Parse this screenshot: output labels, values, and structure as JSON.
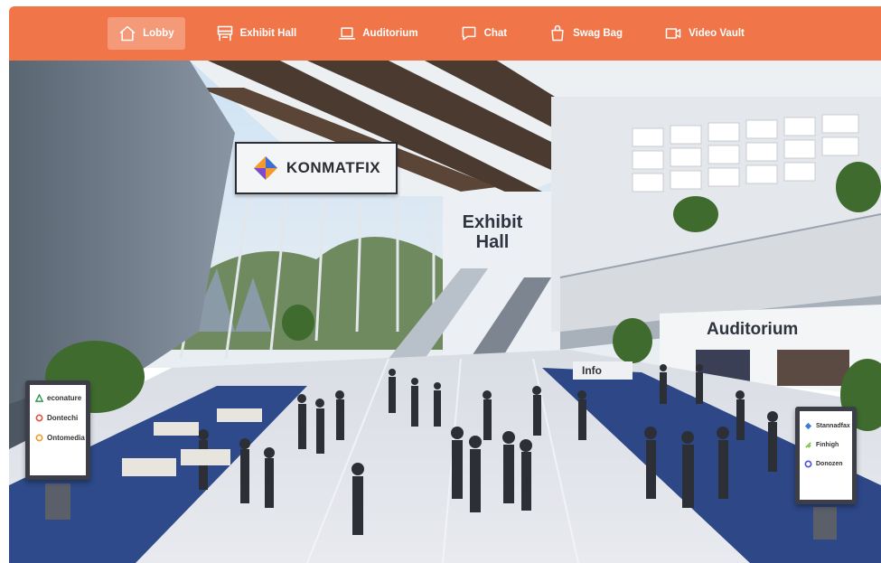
{
  "nav": {
    "items": [
      {
        "label": "Lobby",
        "icon": "home-icon",
        "active": true
      },
      {
        "label": "Exhibit Hall",
        "icon": "booth-icon",
        "active": false
      },
      {
        "label": "Auditorium",
        "icon": "laptop-icon",
        "active": false
      },
      {
        "label": "Chat",
        "icon": "chat-bubble-icon",
        "active": false
      },
      {
        "label": "Swag Bag",
        "icon": "shopping-bag-icon",
        "active": false
      },
      {
        "label": "Video Vault",
        "icon": "video-camera-icon",
        "active": false
      }
    ],
    "bar_color": "#f07548",
    "active_color": "#f59a78"
  },
  "scene": {
    "banner_sign": "KONMATFIX",
    "exhibit_hall_sign_line1": "Exhibit",
    "exhibit_hall_sign_line2": "Hall",
    "auditorium_sign": "Auditorium",
    "info_sign": "Info",
    "kiosk_left": [
      "econature",
      "Dontechi",
      "Ontomedia"
    ],
    "kiosk_right": [
      "Stannadfax",
      "Finhigh",
      "Donozen"
    ]
  }
}
